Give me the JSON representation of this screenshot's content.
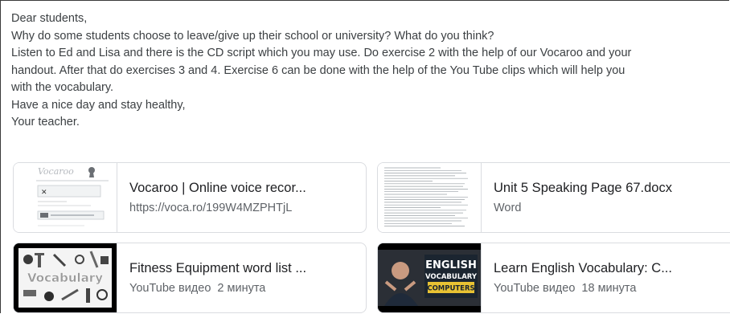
{
  "message": {
    "greeting": "Dear students,",
    "question": "Why do some students choose to leave/give up their school or university? What do you think?",
    "line3": "Listen to Ed and Lisa and there is the CD script which you may use. Do exercise 2 with the help of our Vocaroo and your",
    "line4": "handout. After that do exercises 3 and 4. Exercise 6 can be done with the help of the You Tube clips which will help you",
    "line5": "with the vocabulary.",
    "closing": "Have a nice day and stay healthy,",
    "signature": "Your teacher."
  },
  "attachments": [
    {
      "title": "Vocaroo | Online voice recor...",
      "subtitle": "https://voca.ro/199W4MZPHTjL",
      "thumb_icon": "vocaroo-page-thumbnail"
    },
    {
      "title": "Unit 5 Speaking Page 67.docx",
      "subtitle": "Word",
      "thumb_icon": "document-page-thumbnail"
    },
    {
      "title": "Fitness Equipment word list ...",
      "source": "YouTube видео",
      "duration": "2 минута",
      "thumb_icon": "fitness-equipment-video-thumbnail",
      "thumb_text": "Vocabulary"
    },
    {
      "title": "Learn English Vocabulary: C...",
      "source": "YouTube видео",
      "duration": "18 минута",
      "thumb_icon": "english-vocabulary-video-thumbnail",
      "thumb_lines": [
        "ENGLISH",
        "VOCABULARY",
        "COMPUTERS"
      ]
    }
  ],
  "colors": {
    "text": "#3c4043",
    "title": "#202124",
    "muted": "#5f6368",
    "border": "#dadce0"
  }
}
